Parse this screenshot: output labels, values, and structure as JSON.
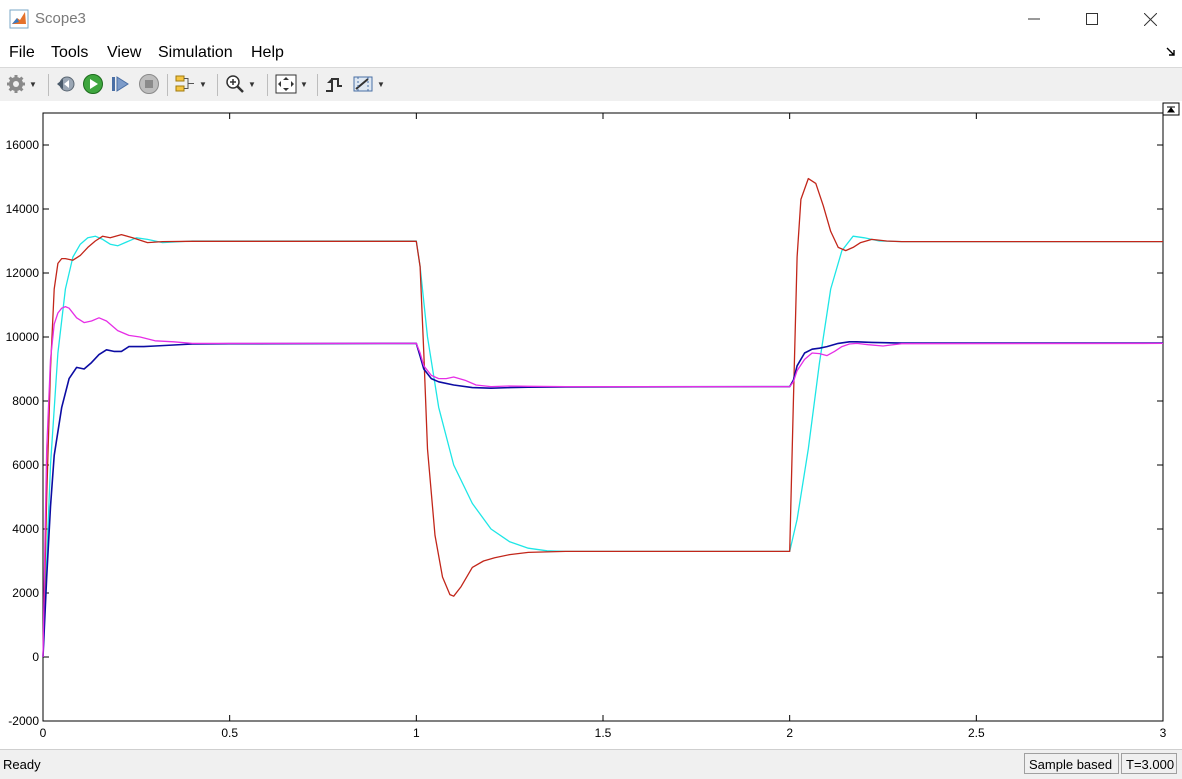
{
  "window": {
    "title": "Scope3"
  },
  "menu": [
    "File",
    "Tools",
    "View",
    "Simulation",
    "Help"
  ],
  "toolbar": {
    "icons": [
      "gear-icon",
      "step-back-icon",
      "run-icon",
      "step-forward-icon",
      "stop-icon",
      "signal-selector-icon",
      "zoom-in-icon",
      "fit-to-view-icon",
      "triggers-icon",
      "cursor-measurements-icon"
    ]
  },
  "status": {
    "text": "Ready",
    "mode": "Sample based",
    "time": "T=3.000"
  },
  "colors": {
    "cyan": "#1ee6e6",
    "red": "#c2261a",
    "blue": "#0c0ca3",
    "magenta": "#e62ee6"
  },
  "chart_data": {
    "type": "line",
    "title": "",
    "xlabel": "",
    "ylabel": "",
    "xlim": [
      0,
      3
    ],
    "ylim": [
      -2000,
      17000
    ],
    "xticks": [
      "0",
      "0.5",
      "1",
      "1.5",
      "2",
      "2.5",
      "3"
    ],
    "yticks": [
      "-2000",
      "0",
      "2000",
      "4000",
      "6000",
      "8000",
      "10000",
      "12000",
      "14000",
      "16000"
    ],
    "grid": false,
    "series": [
      {
        "color": "#1ee6e6",
        "x": [
          0,
          0.01,
          0.02,
          0.04,
          0.06,
          0.08,
          0.1,
          0.12,
          0.14,
          0.16,
          0.18,
          0.2,
          0.22,
          0.25,
          0.28,
          0.32,
          0.4,
          1.0,
          1.01,
          1.03,
          1.06,
          1.1,
          1.15,
          1.2,
          1.25,
          1.3,
          1.35,
          1.4,
          1.5,
          2.0,
          2.02,
          2.05,
          2.08,
          2.11,
          2.14,
          2.17,
          2.2,
          2.24,
          2.3,
          3.0
        ],
        "y": [
          0,
          3000,
          6000,
          9500,
          11500,
          12500,
          12900,
          13100,
          13150,
          13050,
          12900,
          12850,
          12950,
          13100,
          13050,
          12950,
          13000,
          13000,
          12200,
          10000,
          7800,
          6000,
          4800,
          4000,
          3600,
          3400,
          3320,
          3300,
          3300,
          3300,
          4300,
          6500,
          9200,
          11500,
          12700,
          13150,
          13100,
          13000,
          12980,
          12980
        ]
      },
      {
        "color": "#c2261a",
        "x": [
          0,
          0.01,
          0.02,
          0.03,
          0.04,
          0.05,
          0.06,
          0.08,
          0.1,
          0.12,
          0.14,
          0.16,
          0.18,
          0.21,
          0.24,
          0.28,
          0.32,
          0.4,
          1.0,
          1.01,
          1.02,
          1.03,
          1.05,
          1.07,
          1.09,
          1.1,
          1.12,
          1.15,
          1.18,
          1.21,
          1.25,
          1.3,
          1.4,
          2.0,
          2.01,
          2.02,
          2.03,
          2.05,
          2.07,
          2.09,
          2.11,
          2.13,
          2.15,
          2.17,
          2.19,
          2.22,
          2.26,
          2.3,
          3.0
        ],
        "y": [
          0,
          5000,
          9000,
          11500,
          12300,
          12450,
          12450,
          12400,
          12550,
          12800,
          13000,
          13150,
          13100,
          13200,
          13100,
          12950,
          12980,
          12990,
          12990,
          12200,
          9500,
          6500,
          3800,
          2500,
          1950,
          1900,
          2200,
          2800,
          3000,
          3100,
          3200,
          3270,
          3300,
          3300,
          8000,
          12500,
          14300,
          14950,
          14800,
          14100,
          13300,
          12800,
          12700,
          12800,
          12950,
          13050,
          13000,
          12980,
          12980
        ]
      },
      {
        "color": "#0c0ca3",
        "x": [
          0,
          0.01,
          0.02,
          0.03,
          0.05,
          0.07,
          0.09,
          0.11,
          0.13,
          0.15,
          0.17,
          0.19,
          0.21,
          0.23,
          0.25,
          0.27,
          0.3,
          0.35,
          0.4,
          0.5,
          1.0,
          1.01,
          1.02,
          1.04,
          1.06,
          1.1,
          1.15,
          1.2,
          1.25,
          1.3,
          1.4,
          2.0,
          2.01,
          2.02,
          2.04,
          2.06,
          2.08,
          2.1,
          2.13,
          2.16,
          2.18,
          2.22,
          2.3,
          3.0
        ],
        "y": [
          0,
          2500,
          4700,
          6300,
          7800,
          8700,
          9050,
          9000,
          9200,
          9450,
          9600,
          9550,
          9550,
          9700,
          9700,
          9700,
          9720,
          9750,
          9780,
          9790,
          9800,
          9400,
          9000,
          8700,
          8600,
          8500,
          8420,
          8400,
          8420,
          8430,
          8440,
          8450,
          8650,
          9100,
          9500,
          9620,
          9650,
          9700,
          9800,
          9850,
          9850,
          9830,
          9810,
          9810
        ]
      },
      {
        "color": "#e62ee6",
        "x": [
          0,
          0.005,
          0.01,
          0.02,
          0.03,
          0.04,
          0.05,
          0.06,
          0.07,
          0.09,
          0.11,
          0.13,
          0.15,
          0.17,
          0.2,
          0.23,
          0.26,
          0.3,
          0.35,
          0.4,
          0.5,
          1.0,
          1.01,
          1.02,
          1.04,
          1.06,
          1.08,
          1.1,
          1.13,
          1.16,
          1.2,
          1.25,
          1.3,
          1.4,
          2.0,
          2.01,
          2.02,
          2.04,
          2.06,
          2.08,
          2.1,
          2.12,
          2.14,
          2.16,
          2.18,
          2.21,
          2.25,
          2.3,
          3.0
        ],
        "y": [
          0,
          3500,
          6500,
          9300,
          10400,
          10750,
          10900,
          10950,
          10900,
          10600,
          10450,
          10500,
          10600,
          10500,
          10200,
          10050,
          10000,
          9880,
          9850,
          9800,
          9800,
          9800,
          9500,
          9100,
          8800,
          8700,
          8700,
          8750,
          8650,
          8500,
          8450,
          8470,
          8460,
          8450,
          8450,
          8600,
          8950,
          9300,
          9500,
          9480,
          9420,
          9550,
          9700,
          9780,
          9800,
          9760,
          9720,
          9790,
          9800
        ]
      }
    ]
  }
}
